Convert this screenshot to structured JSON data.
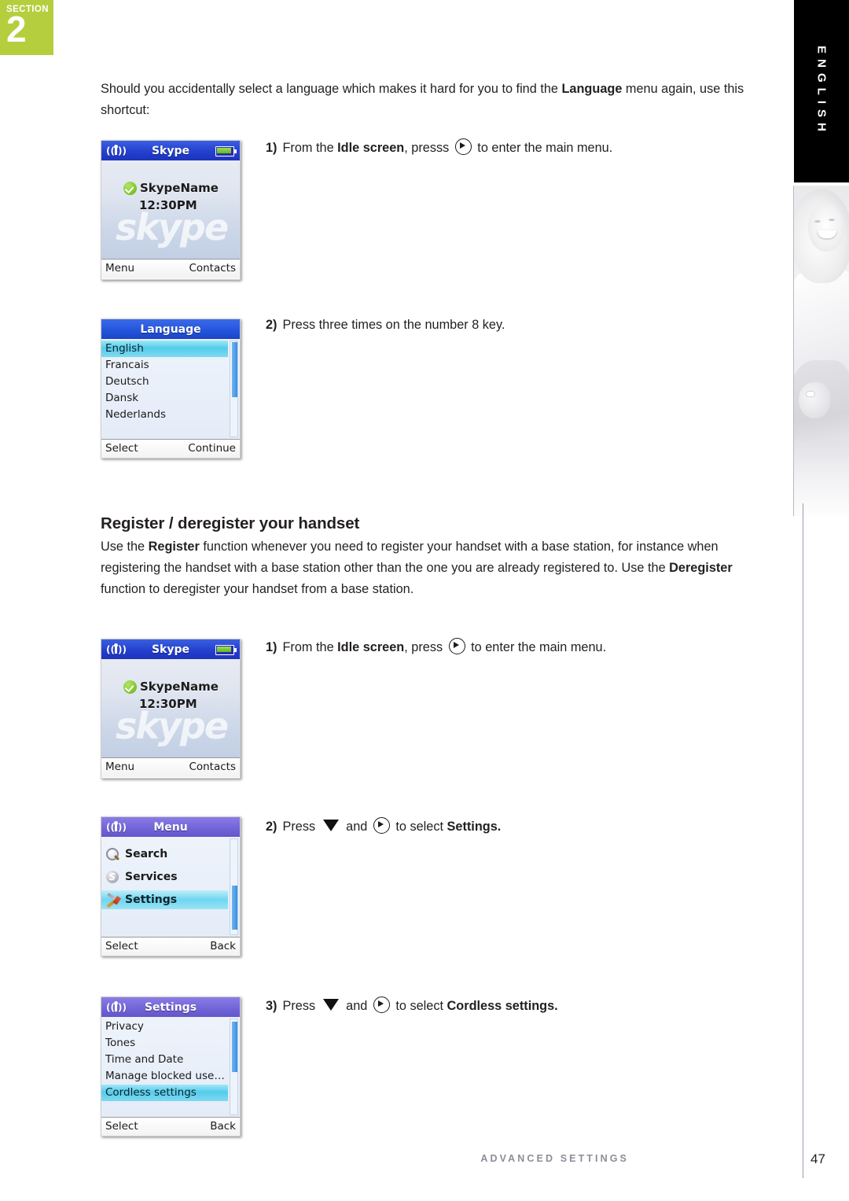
{
  "section_tab": {
    "word": "SECTION",
    "number": "2"
  },
  "language_tab": {
    "label": "ENGLISH"
  },
  "intro": {
    "text_before_bold": "Should you accidentally select a language which makes it hard for you to find the ",
    "bold": "Language",
    "text_after_bold": " menu again, use this shortcut:"
  },
  "steps_language": [
    {
      "num": "1)",
      "pre": "From the ",
      "bold": "Idle screen",
      "mid": ", presss ",
      "icon": "circle-right-arrow-icon",
      "post": " to enter the main menu."
    },
    {
      "num": "2)",
      "pre": "Press three times on the number 8 key.",
      "bold": "",
      "mid": "",
      "post": ""
    }
  ],
  "heading": "Register / deregister your handset",
  "register_para": {
    "p1": "Use the ",
    "b1": "Register",
    "p2": " function whenever you need to register your handset with a base station, for instance when registering the handset with a base station other than the one you are already registered to. Use the ",
    "b2": "Deregister",
    "p3": " function to deregister your handset from a base station."
  },
  "steps_register": [
    {
      "num": "1)",
      "pre": "From the ",
      "bold": "Idle screen",
      "mid": ", press ",
      "post": " to enter the main menu."
    },
    {
      "num": "2)",
      "pre": "Press ",
      "mid": " and ",
      "post": " to select ",
      "bold": "Settings."
    },
    {
      "num": "3)",
      "pre": "Press ",
      "mid": " and ",
      "post": " to select ",
      "bold": "Cordless settings."
    }
  ],
  "screens": {
    "idle": {
      "title": "Skype",
      "username": "SkypeName",
      "time": "12:30PM",
      "watermark": "skype",
      "left_softkey": "Menu",
      "right_softkey": "Contacts"
    },
    "language": {
      "title": "Language",
      "items": [
        "English",
        "Francais",
        "Deutsch",
        "Dansk",
        "Nederlands"
      ],
      "selected_index": 0,
      "left_softkey": "Select",
      "right_softkey": "Continue"
    },
    "menu": {
      "title": "Menu",
      "items": [
        {
          "label": "Search",
          "icon": "magnifier-icon"
        },
        {
          "label": "Services",
          "icon": "skype-s-icon"
        },
        {
          "label": "Settings",
          "icon": "tools-icon"
        }
      ],
      "selected_index": 2,
      "left_softkey": "Select",
      "right_softkey": "Back"
    },
    "settings": {
      "title": "Settings",
      "items": [
        "Privacy",
        "Tones",
        "Time and Date",
        "Manage blocked use…",
        "Cordless settings"
      ],
      "selected_index": 4,
      "left_softkey": "Select",
      "right_softkey": "Back"
    }
  },
  "footer": {
    "label": "ADVANCED SETTINGS",
    "page": "47"
  },
  "colors": {
    "section_green": "#b4ce3e",
    "tab_black": "#000000",
    "screen_header_blue": "#2540cf",
    "screen_header_purple": "#7265d8",
    "selection_cyan": "#55cdec",
    "footer_gray": "#8d8d99"
  }
}
